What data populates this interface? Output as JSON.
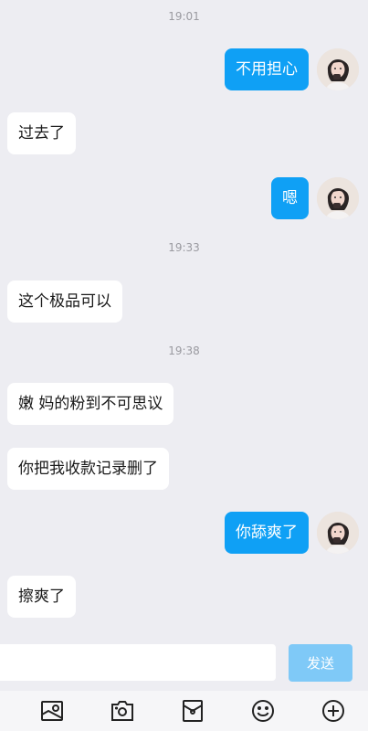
{
  "timestamps": [
    "19:01",
    "19:33",
    "19:38"
  ],
  "messages": [
    {
      "side": "right",
      "text": "不用担心"
    },
    {
      "side": "left",
      "text": "过去了"
    },
    {
      "side": "right",
      "text": "嗯"
    },
    {
      "side": "left",
      "text": "这个极品可以"
    },
    {
      "side": "left",
      "text": "嫩 妈的粉到不可思议"
    },
    {
      "side": "left",
      "text": "你把我收款记录删了"
    },
    {
      "side": "right",
      "text": "你舔爽了"
    },
    {
      "side": "left",
      "text": "擦爽了"
    }
  ],
  "input": {
    "value": "",
    "placeholder": ""
  },
  "send_label": "发送",
  "toolbar_icons": [
    "image-icon",
    "camera-icon",
    "red-packet-icon",
    "emoji-icon",
    "plus-icon"
  ],
  "colors": {
    "background": "#ededf2",
    "incoming_bubble": "#ffffff",
    "outgoing_bubble": "#0fa0f5",
    "send_button": "#7fc9f7"
  }
}
